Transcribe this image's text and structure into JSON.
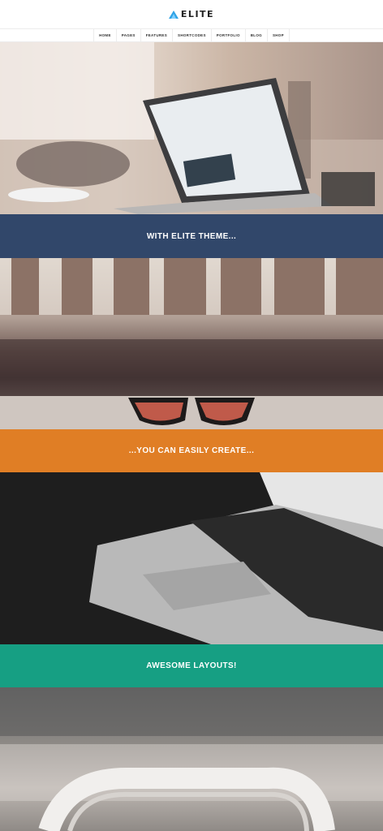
{
  "header": {
    "logo_text": "ELITE",
    "logo_icon": "triangle-logo-icon"
  },
  "nav": {
    "items": [
      {
        "label": "HOME"
      },
      {
        "label": "PAGES"
      },
      {
        "label": "FEATURES"
      },
      {
        "label": "SHORTCODES"
      },
      {
        "label": "PORTFOLIO"
      },
      {
        "label": "BLOG"
      },
      {
        "label": "SHOP"
      }
    ]
  },
  "sections": [
    {
      "photo": "laptop-on-desk-photo",
      "band_text": "WITH ELITE THEME...",
      "band_color": "#31476a"
    },
    {
      "photo": "sunglasses-on-table-photo",
      "band_text": "...YOU CAN EASILY CREATE...",
      "band_color": "#e07e25"
    },
    {
      "photo": "laptop-keyboard-photo",
      "band_text": "AWESOME LAYOUTS!",
      "band_color": "#169f83"
    },
    {
      "photo": "headphones-photo"
    }
  ],
  "colors": {
    "accent_logo": "#2fa3e6"
  }
}
